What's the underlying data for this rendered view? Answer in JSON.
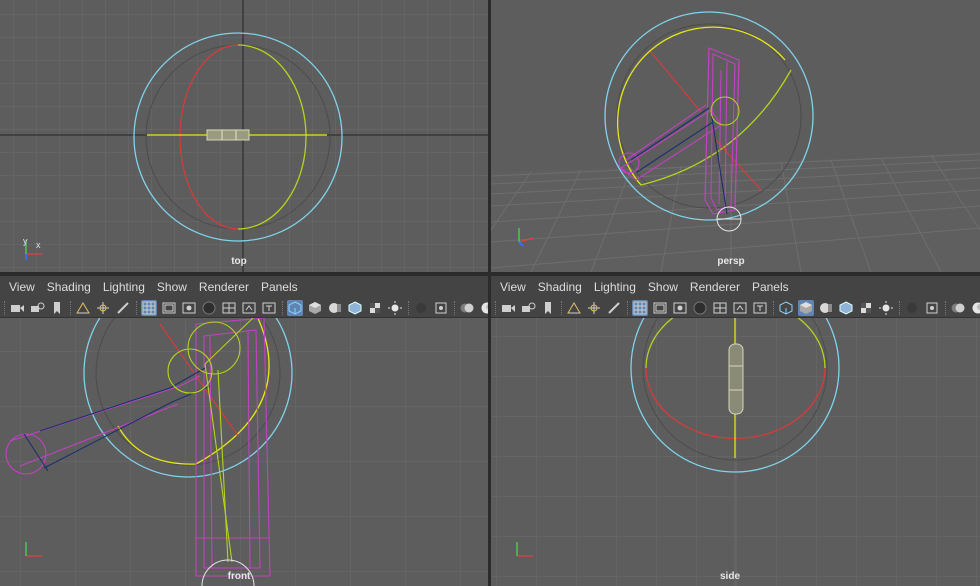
{
  "viewports": {
    "top": {
      "label": "top"
    },
    "persp": {
      "label": "persp"
    },
    "front": {
      "label": "front"
    },
    "side": {
      "label": "side"
    }
  },
  "panel_menu": [
    "View",
    "Shading",
    "Lighting",
    "Show",
    "Renderer",
    "Panels"
  ],
  "toolbar_icons": [
    "camera-select-icon",
    "camera-attributes-icon",
    "bookmark-icon",
    "image-plane-icon",
    "2d-pan-zoom-icon",
    "grease-pencil-icon",
    "grid-icon",
    "film-gate-icon",
    "resolution-gate-icon",
    "gate-mask-icon",
    "field-chart-icon",
    "safe-action-icon",
    "safe-title-icon",
    "wireframe-icon",
    "smooth-shade-icon",
    "default-material-icon",
    "wireframe-on-shaded-icon",
    "textured-icon",
    "use-all-lights-icon",
    "shadows-icon",
    "isolate-select-icon",
    "xray-icon",
    "xray-joints-icon"
  ],
  "axis": {
    "x": "x",
    "y": "y",
    "z": "z"
  },
  "colors": {
    "viewport_bg": "#5d5d5d",
    "grid_line": "#6b6b6b",
    "grid_axis": "#232323",
    "manipulator_ring": "#7fd3ea",
    "rotate_x": "#d43c3c",
    "rotate_y": "#b2d41c",
    "rotate_z": "#e6e619",
    "wire_magenta": "#c242c2",
    "wire_navy": "#1c2f6e",
    "menu_bg": "#444444",
    "active_button": "#5f86b3"
  }
}
